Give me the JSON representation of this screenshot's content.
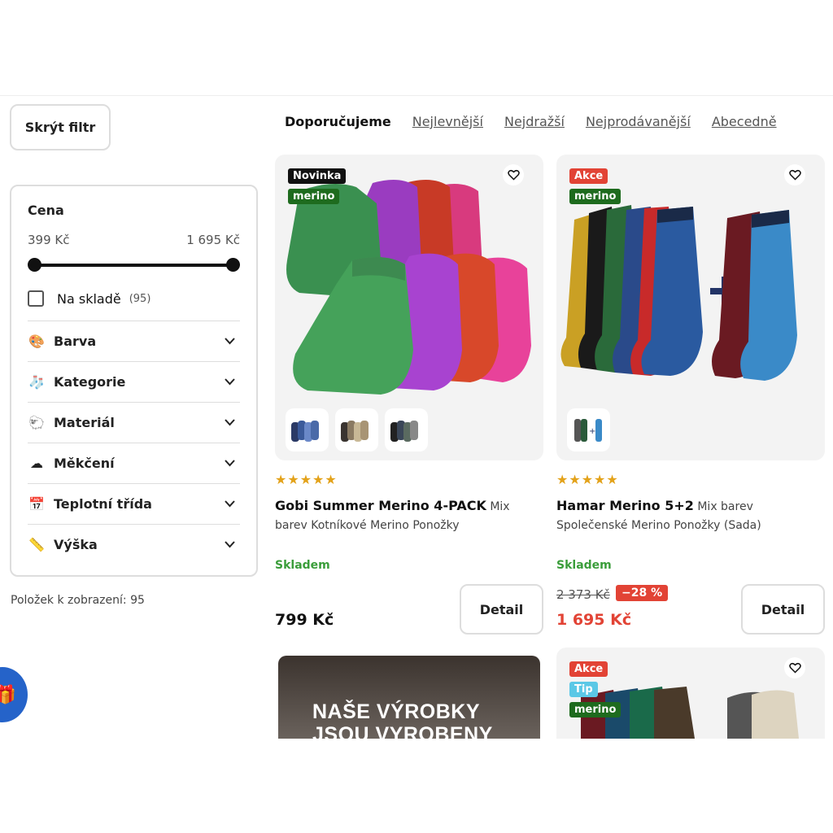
{
  "filter_button": "Skrýt filtr",
  "sort": {
    "active": "Doporučujeme",
    "options": [
      "Nejlevnější",
      "Nejdražší",
      "Nejprodávanější",
      "Abecedně"
    ]
  },
  "filter": {
    "price_title": "Cena",
    "price_min": "399 Kč",
    "price_max": "1 695 Kč",
    "in_stock_label": "Na skladě",
    "in_stock_count": "(95)",
    "facets": [
      {
        "label": "Barva",
        "icon": "palette-icon"
      },
      {
        "label": "Kategorie",
        "icon": "sock-icon"
      },
      {
        "label": "Materiál",
        "icon": "sheep-icon"
      },
      {
        "label": "Měkčení",
        "icon": "cotton-icon"
      },
      {
        "label": "Teplotní třída",
        "icon": "calendar-icon"
      },
      {
        "label": "Výška",
        "icon": "ruler-icon"
      }
    ],
    "items_count_text": "Položek k zobrazení: 95"
  },
  "products": [
    {
      "badges": [
        "Novinka",
        "merino"
      ],
      "name_bold": "Gobi Summer Merino 4-PACK",
      "name_rest": "Mix barev Kotníkové Merino Ponožky",
      "rating": "★★★★★",
      "stock": "Skladem",
      "price": "799 Kč",
      "detail": "Detail"
    },
    {
      "badges": [
        "Akce",
        "merino"
      ],
      "name_bold": "Hamar Merino 5+2",
      "name_rest": "Mix barev Společenské Merino Ponožky (Sada)",
      "rating": "★★★★★",
      "stock": "Skladem",
      "old_price": "2 373 Kč",
      "discount": "−28 %",
      "price": "1 695 Kč",
      "detail": "Detail"
    }
  ],
  "banner_text": "NAŠE VÝROBKY JSOU VYROBENY",
  "card4_badges": [
    "Akce",
    "Tip",
    "merino"
  ],
  "colors": {
    "accent_green": "#3a9d3a",
    "sale_red": "#e24335",
    "star": "#e3a21a"
  }
}
